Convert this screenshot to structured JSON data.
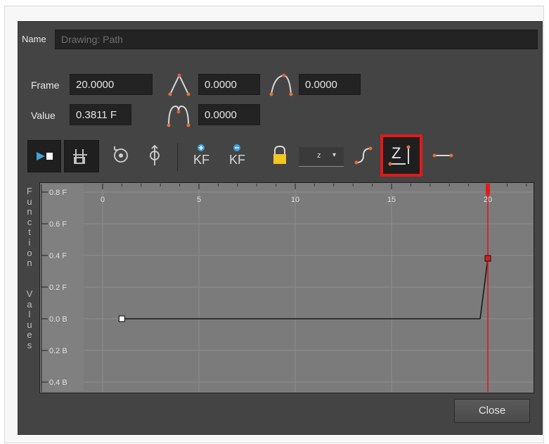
{
  "dialog": {
    "name_label": "Name",
    "name_value": "Drawing: Path",
    "frame_label": "Frame",
    "frame_value": "20.0000",
    "value_label": "Value",
    "value_value": "0.3811 F",
    "ease_in_value": "0.0000",
    "ease_out_value": "0.0000",
    "continuity_value": "0.0000",
    "dropdown_value": "z",
    "kf_add_label": "KF",
    "kf_remove_label": "KF",
    "close_label": "Close"
  },
  "toolbar": {
    "icons": [
      "play-stop-icon",
      "waypoint-icon",
      "rotate-icon",
      "position-icon",
      "add-keyframe-icon",
      "remove-keyframe-icon",
      "lock-icon",
      "dropdown",
      "bezier-icon",
      "constant-segment-icon",
      "linear-icon"
    ],
    "highlighted": "constant-segment-icon",
    "highlight_color": "#e3191b",
    "constant_segment_glyph": "Z"
  },
  "graph": {
    "vertical_label": "Function Values",
    "y_ticks": [
      "0.8 F",
      "0.6 F",
      "0.4 F",
      "0.2 F",
      "0.0 B",
      "0.2 B",
      "0.4 B"
    ],
    "x_ticks": [
      "0",
      "5",
      "10",
      "15",
      "20"
    ],
    "current_frame": 20,
    "playhead_color": "#e3191b",
    "curve_color": "#1a1a1a"
  }
}
